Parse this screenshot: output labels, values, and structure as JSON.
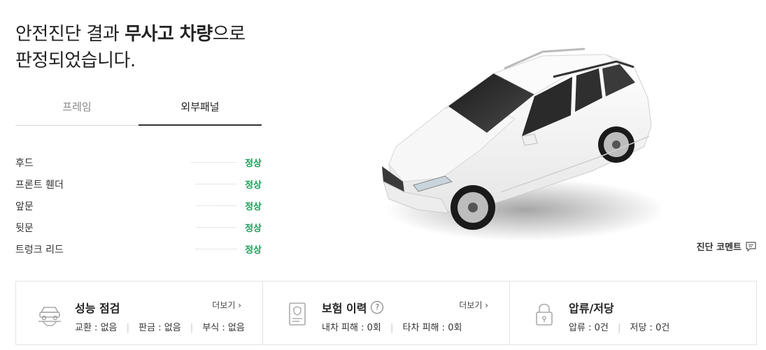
{
  "headline": {
    "line1_prefix": "안전진단 결과 ",
    "line1_bold": "무사고 차량",
    "line1_suffix": "으로",
    "line2": "판정되었습니다."
  },
  "tabs": [
    {
      "label": "프레임",
      "active": false
    },
    {
      "label": "외부패널",
      "active": true
    }
  ],
  "parts": [
    {
      "name": "후드",
      "status": "정상"
    },
    {
      "name": "프론트 휀더",
      "status": "정상"
    },
    {
      "name": "앞문",
      "status": "정상"
    },
    {
      "name": "뒷문",
      "status": "정상"
    },
    {
      "name": "트렁크 리드",
      "status": "정상"
    }
  ],
  "comment_link": "진단 코멘트",
  "cards": [
    {
      "title": "성능 점검",
      "more": "더보기",
      "stats": [
        {
          "label": "교환",
          "value": "없음"
        },
        {
          "label": "판금",
          "value": "없음"
        },
        {
          "label": "부식",
          "value": "없음"
        }
      ]
    },
    {
      "title": "보험 이력",
      "help": "?",
      "more": "더보기",
      "stats": [
        {
          "label": "내차 피해",
          "value": "0회"
        },
        {
          "label": "타차 피해",
          "value": "0회"
        }
      ]
    },
    {
      "title": "압류/저당",
      "stats": [
        {
          "label": "압류",
          "value": "0건"
        },
        {
          "label": "저당",
          "value": "0건"
        }
      ]
    }
  ]
}
